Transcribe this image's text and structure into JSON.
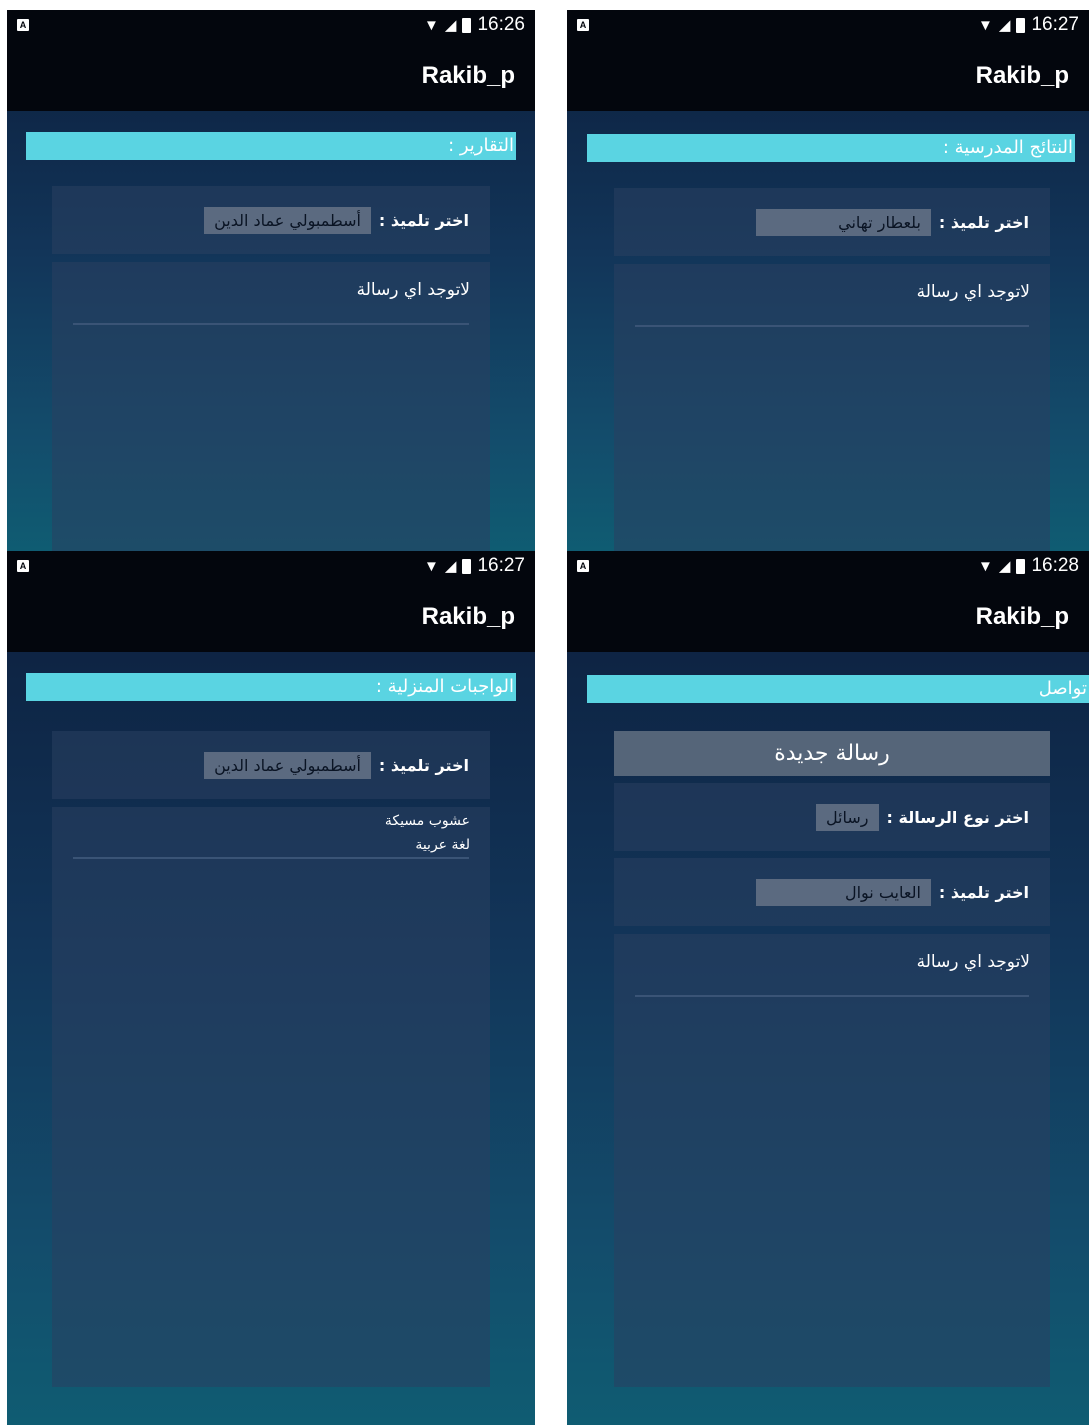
{
  "screens": [
    {
      "time": "16:26",
      "app_title": "Rakib_p",
      "section_title": "التقارير :",
      "picker_label": "اختر تلميذ :",
      "picker_value": "أسطمبولي عماد الدين",
      "message": "لاتوجد اي رسالة"
    },
    {
      "time": "16:27",
      "app_title": "Rakib_p",
      "section_title": "النتائج المدرسية :",
      "picker_label": "اختر تلميذ :",
      "picker_value": "بلعطار تهاني",
      "message": "لاتوجد اي رسالة"
    },
    {
      "time": "16:27",
      "app_title": "Rakib_p",
      "section_title": "الواجبات المنزلية :",
      "picker_label": "اختر تلميذ :",
      "picker_value": "أسطمبولي عماد الدين",
      "items": [
        "عشوب مسيكة",
        "لغة عربية"
      ]
    },
    {
      "time": "16:28",
      "app_title": "Rakib_p",
      "section_title": "تواصل",
      "new_message_label": "رسالة جديدة",
      "type_label": "اختر نوع الرسالة :",
      "type_value": "رسائل",
      "picker_label": "اختر تلميذ :",
      "picker_value": "العايب نوال",
      "message": "لاتوجد اي رسالة"
    }
  ],
  "status_icons": [
    "android-notification-icon",
    "wifi-icon",
    "signal-icon",
    "battery-charging-icon"
  ]
}
